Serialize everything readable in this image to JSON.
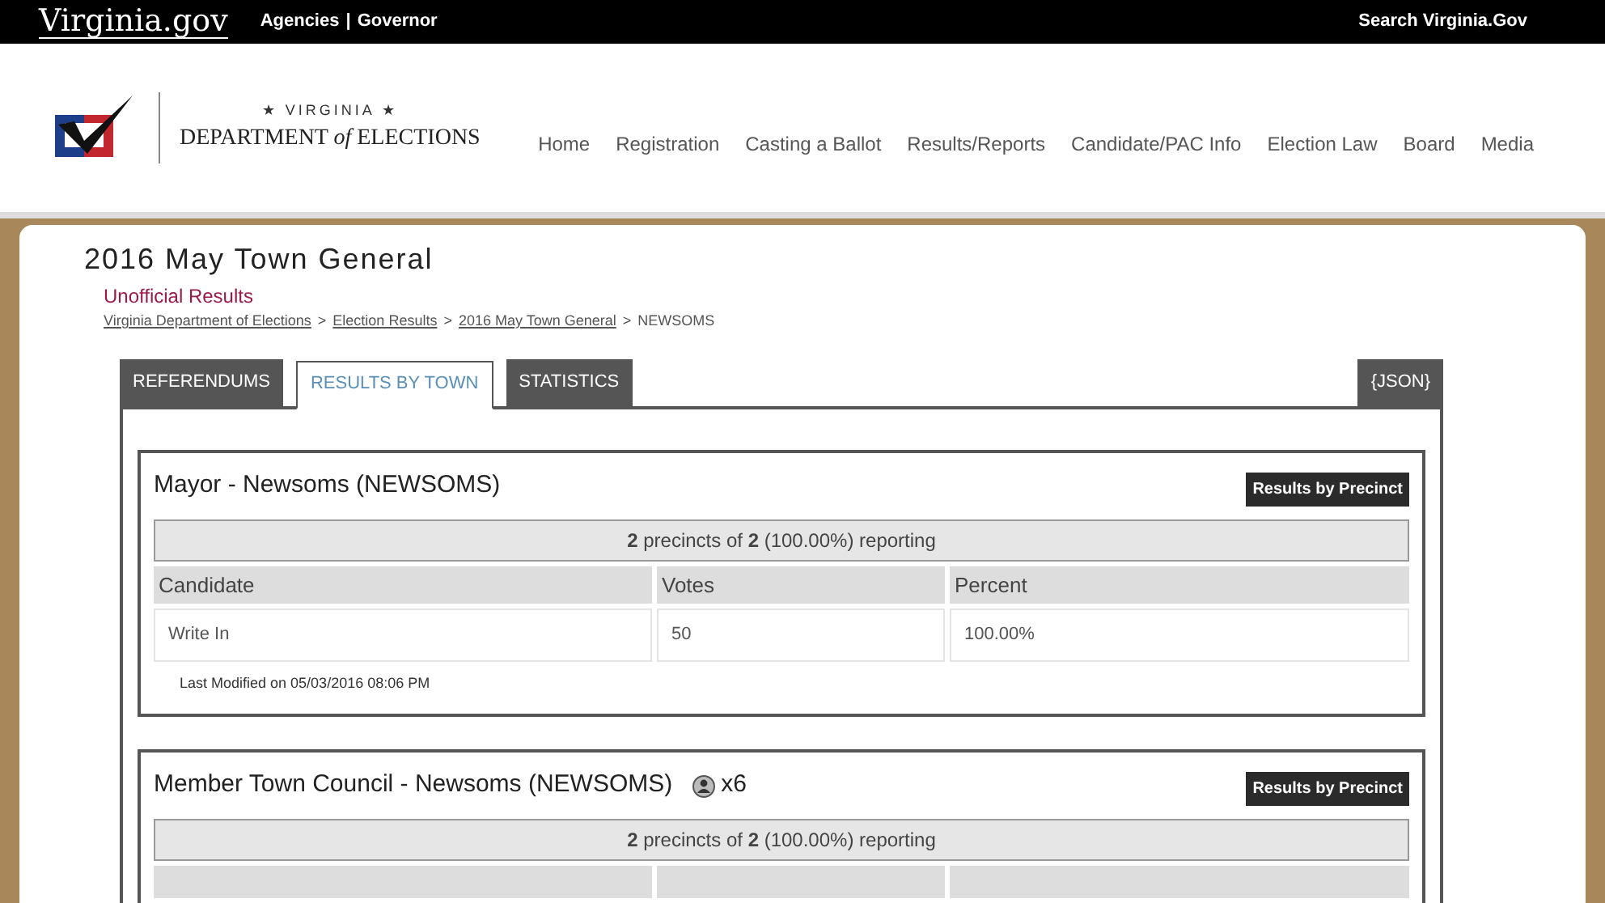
{
  "topbar": {
    "logo": "Virginia.gov",
    "links": [
      "Agencies",
      "Governor"
    ],
    "separator": "|",
    "search": "Search Virginia.Gov"
  },
  "header": {
    "logo_small": "★ VIRGINIA ★",
    "logo_main_1": "DEPARTMENT",
    "logo_of": "of",
    "logo_main_2": "ELECTIONS",
    "nav": [
      "Home",
      "Registration",
      "Casting a Ballot",
      "Results/Reports",
      "Candidate/PAC Info",
      "Election Law",
      "Board",
      "Media"
    ]
  },
  "page": {
    "title": "2016 May Town General",
    "subtitle": "Unofficial Results",
    "breadcrumbs": [
      {
        "label": "Virginia Department of Elections",
        "link": true
      },
      {
        "label": "Election Results",
        "link": true
      },
      {
        "label": "2016 May Town General",
        "link": true
      },
      {
        "label": "NEWSOMS",
        "link": false
      }
    ],
    "breadcrumb_separator": ">",
    "tabs": [
      {
        "label": "REFERENDUMS",
        "selected": false
      },
      {
        "label": "RESULTS BY TOWN",
        "selected": true
      },
      {
        "label": "STATISTICS",
        "selected": false
      }
    ],
    "json_button": "{JSON}",
    "races": [
      {
        "title": "Mayor - Newsoms (NEWSOMS)",
        "button": "Results by Precinct",
        "reporting": "**2** precincts of **2** (100.00%) reporting",
        "columns": [
          "Candidate",
          "Votes",
          "Percent"
        ],
        "rows": [
          [
            "Write In",
            "50",
            "100.00%"
          ]
        ],
        "modified": "Last Modified on 05/03/2016 08:06 PM"
      },
      {
        "title": "Member Town Council - Newsoms (NEWSOMS)",
        "seats": "x6",
        "button": "Results by Precinct",
        "reporting": "**2** precincts of **2** (100.00%) reporting"
      }
    ]
  }
}
